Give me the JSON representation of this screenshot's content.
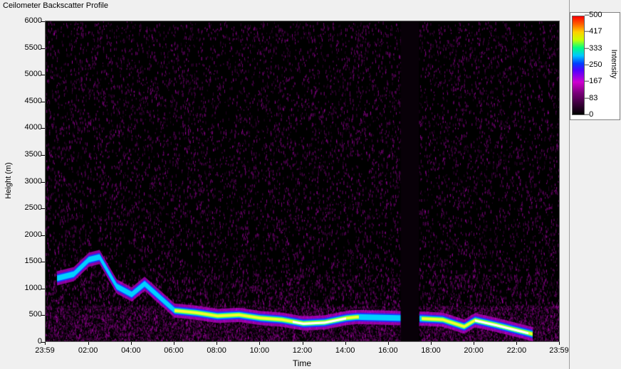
{
  "window": {
    "title": "Ceilometer Backscatter Profile"
  },
  "chart_data": {
    "type": "heatmap",
    "title": "Ceilometer Backscatter Profile",
    "xlabel": "Time",
    "ylabel": "Height (m)",
    "ylim": [
      0,
      6000
    ],
    "x_tick_labels": [
      "23:59",
      "02:00",
      "04:00",
      "06:00",
      "08:00",
      "10:00",
      "12:00",
      "14:00",
      "16:00",
      "18:00",
      "20:00",
      "22:00",
      "23:59"
    ],
    "y_tick_labels": [
      "0",
      "500",
      "1000",
      "1500",
      "2000",
      "2500",
      "3000",
      "3500",
      "4000",
      "4500",
      "5000",
      "5500",
      "6000"
    ],
    "colorbar": {
      "label": "Intensity",
      "range": [
        0,
        500
      ],
      "ticks": [
        "0",
        "83",
        "167",
        "250",
        "333",
        "417",
        "500"
      ]
    },
    "data_gap_hours": [
      16.55,
      17.4
    ],
    "layer_height_m": [
      {
        "t": 0.5,
        "h": 1200
      },
      {
        "t": 1.3,
        "h": 1280
      },
      {
        "t": 2.0,
        "h": 1550
      },
      {
        "t": 2.5,
        "h": 1600
      },
      {
        "t": 3.3,
        "h": 1050
      },
      {
        "t": 4.0,
        "h": 900
      },
      {
        "t": 4.6,
        "h": 1100
      },
      {
        "t": 6.0,
        "h": 600
      },
      {
        "t": 7.0,
        "h": 560
      },
      {
        "t": 8.0,
        "h": 500
      },
      {
        "t": 9.0,
        "h": 520
      },
      {
        "t": 10.0,
        "h": 460
      },
      {
        "t": 11.0,
        "h": 430
      },
      {
        "t": 12.0,
        "h": 360
      },
      {
        "t": 13.0,
        "h": 380
      },
      {
        "t": 14.0,
        "h": 460
      },
      {
        "t": 14.5,
        "h": 480
      },
      {
        "t": 17.5,
        "h": 450
      },
      {
        "t": 18.5,
        "h": 430
      },
      {
        "t": 19.5,
        "h": 300
      },
      {
        "t": 20.0,
        "h": 420
      },
      {
        "t": 21.0,
        "h": 330
      },
      {
        "t": 22.0,
        "h": 230
      },
      {
        "t": 22.7,
        "h": 160
      }
    ],
    "colors": {
      "background": "#000000",
      "noise": "#c000c0",
      "layer_peak": "#ffffff"
    }
  }
}
